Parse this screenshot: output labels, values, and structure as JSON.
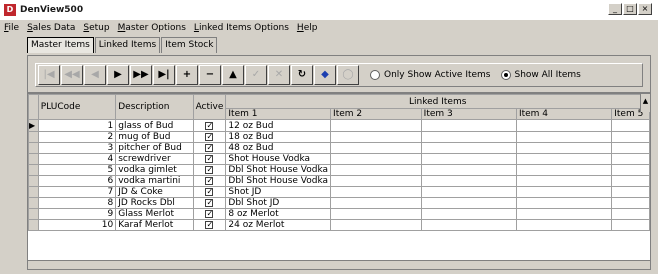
{
  "window": {
    "title": "DenView500",
    "icon_letter": "D",
    "controls": [
      "_",
      "□",
      "×"
    ]
  },
  "menu": [
    "File",
    "Sales Data",
    "Setup",
    "Master Options",
    "Linked Items Options",
    "Help"
  ],
  "tabs": [
    {
      "label": "Master Items",
      "active": true
    },
    {
      "label": "Linked Items",
      "active": false
    },
    {
      "label": "Item Stock",
      "active": false
    }
  ],
  "toolbar": {
    "buttons": [
      {
        "glyph": "|◀",
        "name": "first-record",
        "enabled": false
      },
      {
        "glyph": "◀◀",
        "name": "prev-page",
        "enabled": false
      },
      {
        "glyph": "◀",
        "name": "prev-record",
        "enabled": false
      },
      {
        "glyph": "▶",
        "name": "next-record",
        "enabled": true
      },
      {
        "glyph": "▶▶",
        "name": "next-page",
        "enabled": true
      },
      {
        "glyph": "▶|",
        "name": "last-record",
        "enabled": true
      },
      {
        "glyph": "+",
        "name": "add-record",
        "enabled": true
      },
      {
        "glyph": "−",
        "name": "delete-record",
        "enabled": true
      },
      {
        "glyph": "▲",
        "name": "edit-record",
        "enabled": true
      },
      {
        "glyph": "✓",
        "name": "post-edit",
        "enabled": false
      },
      {
        "glyph": "✕",
        "name": "cancel-edit",
        "enabled": false
      },
      {
        "glyph": "↻",
        "name": "refresh",
        "enabled": true
      },
      {
        "glyph": "◆",
        "name": "filter",
        "enabled": true
      },
      {
        "glyph": "◯",
        "name": "options",
        "enabled": false
      }
    ],
    "radios": [
      {
        "label": "Only Show Active Items",
        "checked": false
      },
      {
        "label": "Show All Items",
        "checked": true
      }
    ]
  },
  "grid": {
    "columns": {
      "plu": "PLUCode",
      "desc": "Description",
      "active": "Active",
      "linked_group": "Linked Items",
      "linked": [
        "Item 1",
        "Item 2",
        "Item 3",
        "Item 4",
        "Item 5"
      ]
    },
    "rows": [
      {
        "plu": "1",
        "desc": "glass of Bud",
        "active": true,
        "item1": "12 oz Bud"
      },
      {
        "plu": "2",
        "desc": "mug of Bud",
        "active": true,
        "item1": "18 oz Bud"
      },
      {
        "plu": "3",
        "desc": "pitcher of Bud",
        "active": true,
        "item1": "48 oz Bud"
      },
      {
        "plu": "4",
        "desc": "screwdriver",
        "active": true,
        "item1": "Shot House Vodka"
      },
      {
        "plu": "5",
        "desc": "vodka gimlet",
        "active": true,
        "item1": "Dbl Shot House Vodka"
      },
      {
        "plu": "6",
        "desc": "vodka martini",
        "active": true,
        "item1": "Dbl Shot House Vodka"
      },
      {
        "plu": "7",
        "desc": "JD & Coke",
        "active": true,
        "item1": "Shot JD"
      },
      {
        "plu": "8",
        "desc": "JD Rocks Dbl",
        "active": true,
        "item1": "Dbl Shot JD"
      },
      {
        "plu": "9",
        "desc": "Glass Merlot",
        "active": true,
        "item1": "8 oz Merlot"
      },
      {
        "plu": "10",
        "desc": "Karaf Merlot",
        "active": true,
        "item1": "24 oz Merlot"
      }
    ],
    "current_row_index": 0
  }
}
